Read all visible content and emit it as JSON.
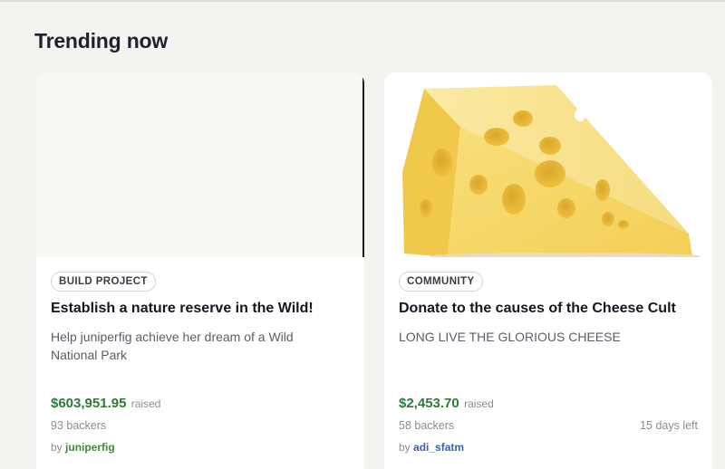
{
  "section": {
    "title": "Trending now"
  },
  "cards": [
    {
      "category": "BUILD PROJECT",
      "title": "Establish a nature reserve in the Wild!",
      "description": "Help juniperfig achieve her dream of a Wild National Park",
      "amount": "$603,951.95",
      "raised_label": "raised",
      "backers": "93 backers",
      "days_left": "",
      "by_label": "by",
      "author": "juniperfig"
    },
    {
      "category": "COMMUNITY",
      "title": "Donate to the causes of the Cheese Cult",
      "description": "LONG LIVE THE GLORIOUS CHEESE",
      "amount": "$2,453.70",
      "raised_label": "raised",
      "backers": "58 backers",
      "days_left": "15 days left",
      "by_label": "by",
      "author": "adi_sfatm"
    }
  ],
  "colors": {
    "background": "#f3f3ef",
    "raised_amount": "#2f7a36",
    "author_green": "#3e8a3e",
    "author_blue": "#3d5fb0"
  }
}
